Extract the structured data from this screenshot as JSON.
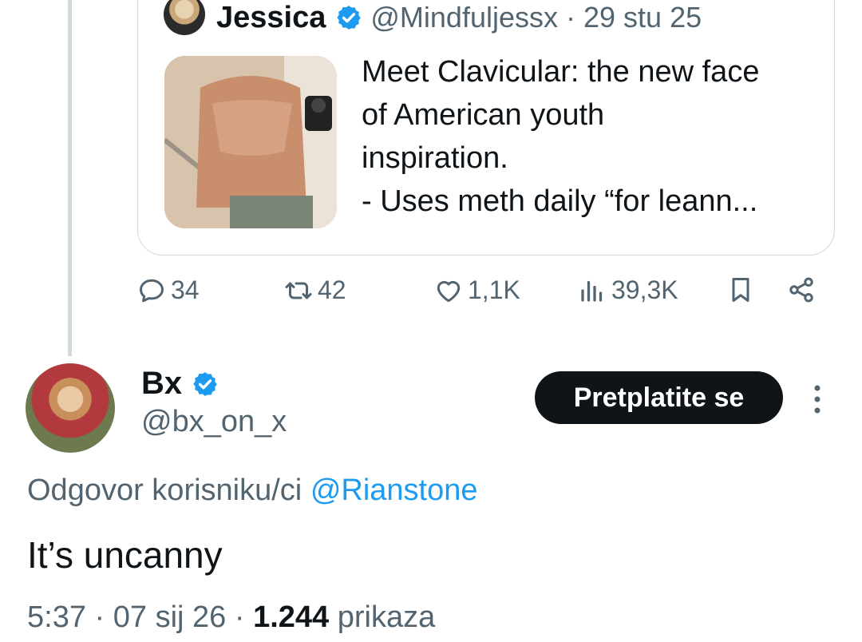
{
  "quoted_tweet": {
    "author_name": "Jessica",
    "handle": "@Mindfuljessx",
    "separator": "·",
    "date": "29 stu 25",
    "text": "Meet Clavicular: the new face\nof American youth\ninspiration.\n- Uses meth daily “for leann..."
  },
  "actions": {
    "replies": "34",
    "retweets": "42",
    "likes": "1,1K",
    "views": "39,3K"
  },
  "reply_tweet": {
    "author_name": "Bx",
    "handle": "@bx_on_x",
    "subscribe_label": "Pretplatite se",
    "reply_prefix": "Odgovor korisniku/ci",
    "reply_mention": "@Rianstone",
    "text": "It’s uncanny",
    "time": "5:37",
    "date": "07 sij 26",
    "views_count": "1.244",
    "views_label": "prikaza"
  },
  "colors": {
    "verified": "#1d9bf0",
    "secondary_text": "#536471",
    "primary_text": "#0f1419",
    "border": "#cfd9de",
    "button_bg": "#0f1419"
  }
}
